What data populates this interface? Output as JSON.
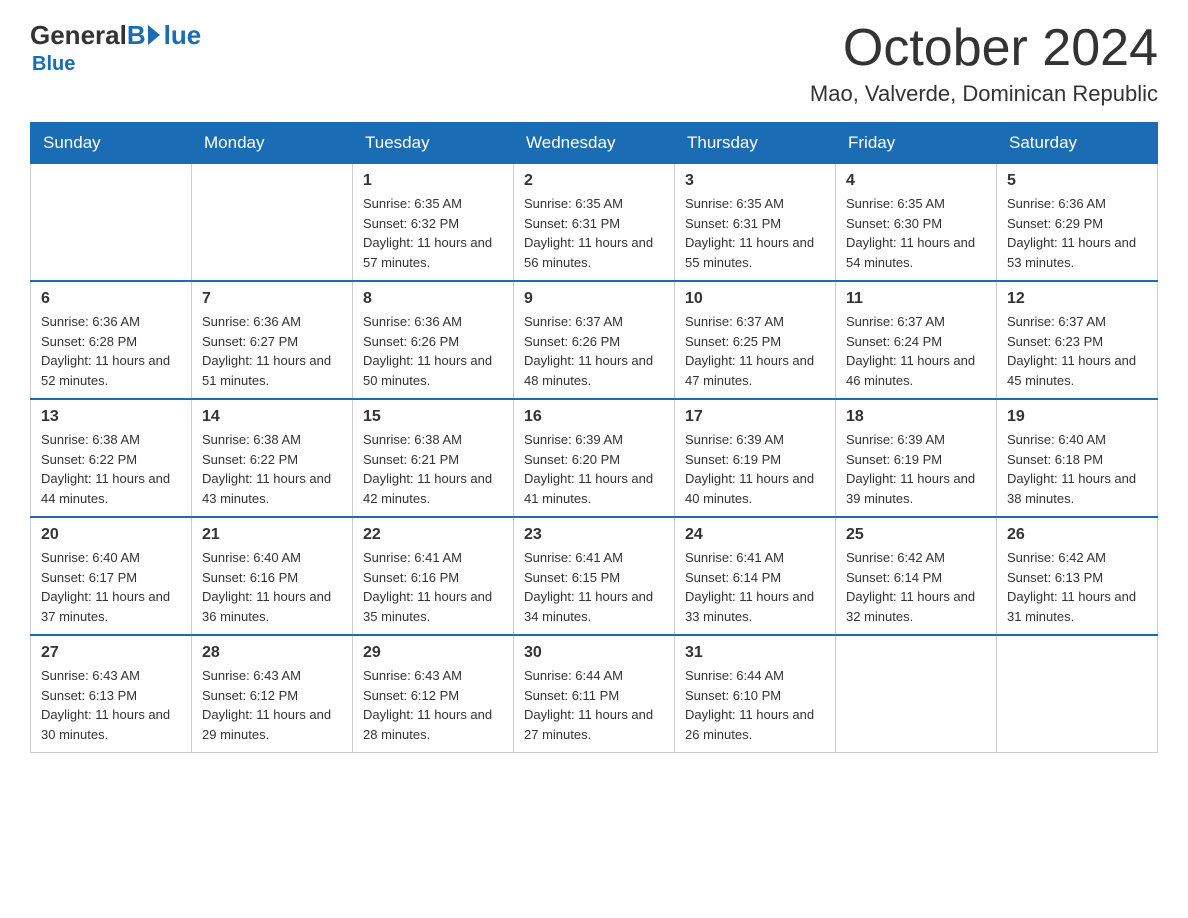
{
  "logo": {
    "general": "General",
    "blue": "Blue"
  },
  "title": {
    "month_year": "October 2024",
    "location": "Mao, Valverde, Dominican Republic"
  },
  "headers": [
    "Sunday",
    "Monday",
    "Tuesday",
    "Wednesday",
    "Thursday",
    "Friday",
    "Saturday"
  ],
  "weeks": [
    [
      {
        "day": "",
        "sunrise": "",
        "sunset": "",
        "daylight": ""
      },
      {
        "day": "",
        "sunrise": "",
        "sunset": "",
        "daylight": ""
      },
      {
        "day": "1",
        "sunrise": "Sunrise: 6:35 AM",
        "sunset": "Sunset: 6:32 PM",
        "daylight": "Daylight: 11 hours and 57 minutes."
      },
      {
        "day": "2",
        "sunrise": "Sunrise: 6:35 AM",
        "sunset": "Sunset: 6:31 PM",
        "daylight": "Daylight: 11 hours and 56 minutes."
      },
      {
        "day": "3",
        "sunrise": "Sunrise: 6:35 AM",
        "sunset": "Sunset: 6:31 PM",
        "daylight": "Daylight: 11 hours and 55 minutes."
      },
      {
        "day": "4",
        "sunrise": "Sunrise: 6:35 AM",
        "sunset": "Sunset: 6:30 PM",
        "daylight": "Daylight: 11 hours and 54 minutes."
      },
      {
        "day": "5",
        "sunrise": "Sunrise: 6:36 AM",
        "sunset": "Sunset: 6:29 PM",
        "daylight": "Daylight: 11 hours and 53 minutes."
      }
    ],
    [
      {
        "day": "6",
        "sunrise": "Sunrise: 6:36 AM",
        "sunset": "Sunset: 6:28 PM",
        "daylight": "Daylight: 11 hours and 52 minutes."
      },
      {
        "day": "7",
        "sunrise": "Sunrise: 6:36 AM",
        "sunset": "Sunset: 6:27 PM",
        "daylight": "Daylight: 11 hours and 51 minutes."
      },
      {
        "day": "8",
        "sunrise": "Sunrise: 6:36 AM",
        "sunset": "Sunset: 6:26 PM",
        "daylight": "Daylight: 11 hours and 50 minutes."
      },
      {
        "day": "9",
        "sunrise": "Sunrise: 6:37 AM",
        "sunset": "Sunset: 6:26 PM",
        "daylight": "Daylight: 11 hours and 48 minutes."
      },
      {
        "day": "10",
        "sunrise": "Sunrise: 6:37 AM",
        "sunset": "Sunset: 6:25 PM",
        "daylight": "Daylight: 11 hours and 47 minutes."
      },
      {
        "day": "11",
        "sunrise": "Sunrise: 6:37 AM",
        "sunset": "Sunset: 6:24 PM",
        "daylight": "Daylight: 11 hours and 46 minutes."
      },
      {
        "day": "12",
        "sunrise": "Sunrise: 6:37 AM",
        "sunset": "Sunset: 6:23 PM",
        "daylight": "Daylight: 11 hours and 45 minutes."
      }
    ],
    [
      {
        "day": "13",
        "sunrise": "Sunrise: 6:38 AM",
        "sunset": "Sunset: 6:22 PM",
        "daylight": "Daylight: 11 hours and 44 minutes."
      },
      {
        "day": "14",
        "sunrise": "Sunrise: 6:38 AM",
        "sunset": "Sunset: 6:22 PM",
        "daylight": "Daylight: 11 hours and 43 minutes."
      },
      {
        "day": "15",
        "sunrise": "Sunrise: 6:38 AM",
        "sunset": "Sunset: 6:21 PM",
        "daylight": "Daylight: 11 hours and 42 minutes."
      },
      {
        "day": "16",
        "sunrise": "Sunrise: 6:39 AM",
        "sunset": "Sunset: 6:20 PM",
        "daylight": "Daylight: 11 hours and 41 minutes."
      },
      {
        "day": "17",
        "sunrise": "Sunrise: 6:39 AM",
        "sunset": "Sunset: 6:19 PM",
        "daylight": "Daylight: 11 hours and 40 minutes."
      },
      {
        "day": "18",
        "sunrise": "Sunrise: 6:39 AM",
        "sunset": "Sunset: 6:19 PM",
        "daylight": "Daylight: 11 hours and 39 minutes."
      },
      {
        "day": "19",
        "sunrise": "Sunrise: 6:40 AM",
        "sunset": "Sunset: 6:18 PM",
        "daylight": "Daylight: 11 hours and 38 minutes."
      }
    ],
    [
      {
        "day": "20",
        "sunrise": "Sunrise: 6:40 AM",
        "sunset": "Sunset: 6:17 PM",
        "daylight": "Daylight: 11 hours and 37 minutes."
      },
      {
        "day": "21",
        "sunrise": "Sunrise: 6:40 AM",
        "sunset": "Sunset: 6:16 PM",
        "daylight": "Daylight: 11 hours and 36 minutes."
      },
      {
        "day": "22",
        "sunrise": "Sunrise: 6:41 AM",
        "sunset": "Sunset: 6:16 PM",
        "daylight": "Daylight: 11 hours and 35 minutes."
      },
      {
        "day": "23",
        "sunrise": "Sunrise: 6:41 AM",
        "sunset": "Sunset: 6:15 PM",
        "daylight": "Daylight: 11 hours and 34 minutes."
      },
      {
        "day": "24",
        "sunrise": "Sunrise: 6:41 AM",
        "sunset": "Sunset: 6:14 PM",
        "daylight": "Daylight: 11 hours and 33 minutes."
      },
      {
        "day": "25",
        "sunrise": "Sunrise: 6:42 AM",
        "sunset": "Sunset: 6:14 PM",
        "daylight": "Daylight: 11 hours and 32 minutes."
      },
      {
        "day": "26",
        "sunrise": "Sunrise: 6:42 AM",
        "sunset": "Sunset: 6:13 PM",
        "daylight": "Daylight: 11 hours and 31 minutes."
      }
    ],
    [
      {
        "day": "27",
        "sunrise": "Sunrise: 6:43 AM",
        "sunset": "Sunset: 6:13 PM",
        "daylight": "Daylight: 11 hours and 30 minutes."
      },
      {
        "day": "28",
        "sunrise": "Sunrise: 6:43 AM",
        "sunset": "Sunset: 6:12 PM",
        "daylight": "Daylight: 11 hours and 29 minutes."
      },
      {
        "day": "29",
        "sunrise": "Sunrise: 6:43 AM",
        "sunset": "Sunset: 6:12 PM",
        "daylight": "Daylight: 11 hours and 28 minutes."
      },
      {
        "day": "30",
        "sunrise": "Sunrise: 6:44 AM",
        "sunset": "Sunset: 6:11 PM",
        "daylight": "Daylight: 11 hours and 27 minutes."
      },
      {
        "day": "31",
        "sunrise": "Sunrise: 6:44 AM",
        "sunset": "Sunset: 6:10 PM",
        "daylight": "Daylight: 11 hours and 26 minutes."
      },
      {
        "day": "",
        "sunrise": "",
        "sunset": "",
        "daylight": ""
      },
      {
        "day": "",
        "sunrise": "",
        "sunset": "",
        "daylight": ""
      }
    ]
  ]
}
